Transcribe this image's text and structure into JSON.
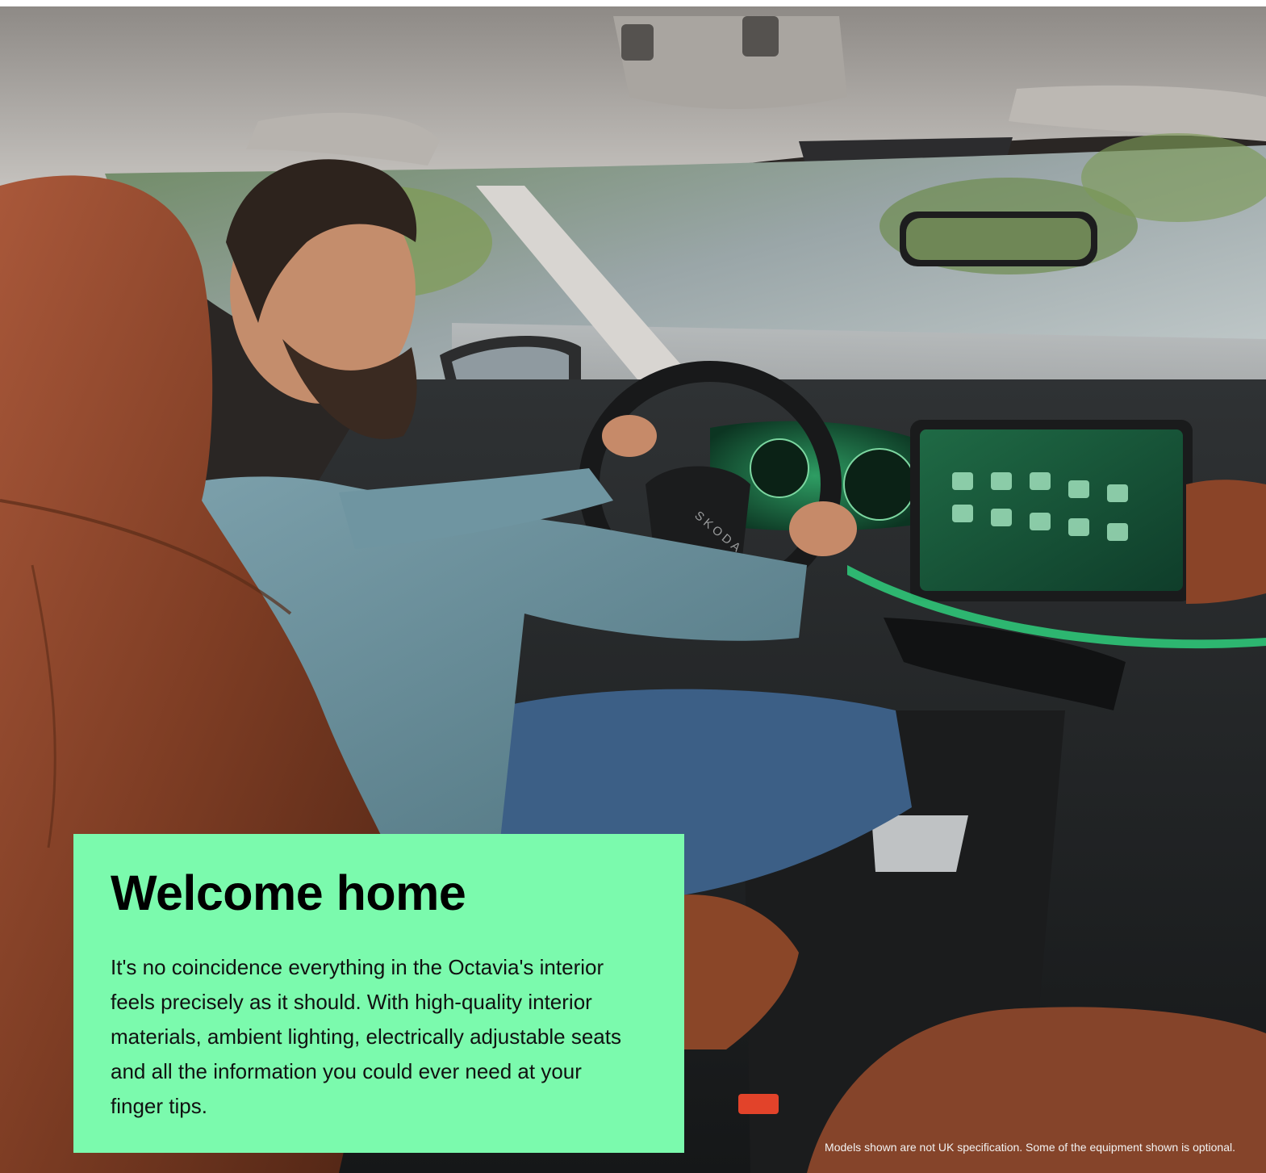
{
  "panel": {
    "headline": "Welcome home",
    "body": "It's no coincidence everything in the Octavia's interior\nfeels precisely as it should. With high-quality interior\nmaterials, ambient lighting, electrically adjustable seats\nand  all the information you could ever need at your\nfinger tips."
  },
  "photo": {
    "steering_wheel_badge": "SKODA"
  },
  "footer": {
    "disclaimer": "Models shown are not UK specification. Some of the equipment shown is optional."
  },
  "colors": {
    "panel_background": "#7bfaad",
    "headline_text": "#000000",
    "disclaimer_text": "#f2f2f2"
  }
}
